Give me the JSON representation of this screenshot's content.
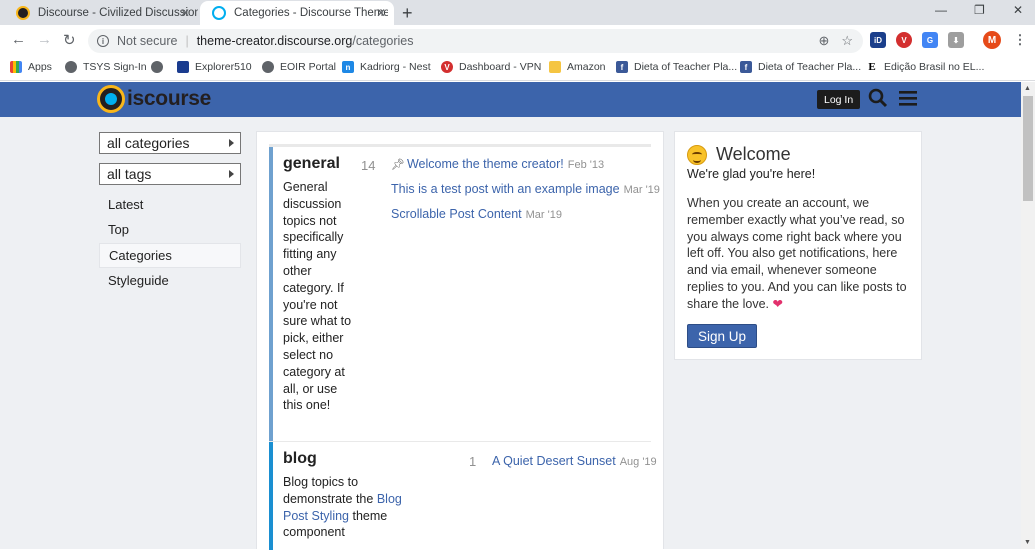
{
  "browser": {
    "tabs": [
      {
        "title": "Discourse - Civilized Discussion",
        "active": false
      },
      {
        "title": "Categories - Discourse Theme Cr",
        "active": true
      }
    ],
    "address": {
      "not_secure": "Not secure",
      "host": "theme-creator.discourse.org",
      "path": "/categories"
    },
    "profile_initial": "M",
    "bookmarks": [
      {
        "label": "Apps",
        "icon": "apps-grid-icon"
      },
      {
        "label": "TSYS Sign-In",
        "icon": "globe-icon"
      },
      {
        "label": "",
        "icon": "globe-icon"
      },
      {
        "label": "Explorer510",
        "icon": "explorer-icon"
      },
      {
        "label": "EOIR Portal",
        "icon": "globe-icon"
      },
      {
        "label": "Kadriorg - Nest",
        "icon": "nest-icon"
      },
      {
        "label": "Dashboard - VPN",
        "icon": "vpn-icon"
      },
      {
        "label": "Amazon",
        "icon": "folder-icon"
      },
      {
        "label": "Dieta of Teacher Pla...",
        "icon": "facebook-icon"
      },
      {
        "label": "Dieta of Teacher Pla...",
        "icon": "facebook-icon"
      },
      {
        "label": "Edição Brasil no EL...",
        "icon": "elpais-icon"
      }
    ]
  },
  "header": {
    "logo_text": "iscourse",
    "login_label": "Log In"
  },
  "sidebar": {
    "dropdowns": [
      "all categories",
      "all tags"
    ],
    "nav": [
      "Latest",
      "Top",
      "Categories",
      "Styleguide"
    ]
  },
  "categories": [
    {
      "name": "general",
      "color": "#6fa1cf",
      "description": "General discussion topics not specifically fitting any other category. If you're not sure what to pick, either select no category at all, or use this one!",
      "count": "14",
      "topics": [
        {
          "title": "Welcome the theme creator!",
          "date": "Feb '13",
          "pinned": true
        },
        {
          "title": "This is a test post with an example image",
          "date": "Mar '19",
          "pinned": false
        },
        {
          "title": "Scrollable Post Content",
          "date": "Mar '19",
          "pinned": false
        }
      ]
    },
    {
      "name": "blog",
      "color": "#1a8fd1",
      "description_pre": "Blog topics to demonstrate the",
      "description_link": "Blog Post Styling",
      "description_post": "theme component",
      "count": "1",
      "topics": [
        {
          "title": "A Quiet Desert Sunset",
          "date": "Aug '19",
          "pinned": false
        }
      ]
    }
  ],
  "welcome": {
    "title": "Welcome",
    "subtitle": "We're glad you're here!",
    "body": "When you create an account, we remember exactly what you’ve read, so you always come right back where you left off. You also get notifications, here and via email, whenever someone replies to you. And you can like posts to share the love.",
    "heart": "❤",
    "signup_label": "Sign Up"
  },
  "colors": {
    "header": "#3c64ab",
    "link": "#3c64ab",
    "page_bg": "#eef0f3"
  }
}
